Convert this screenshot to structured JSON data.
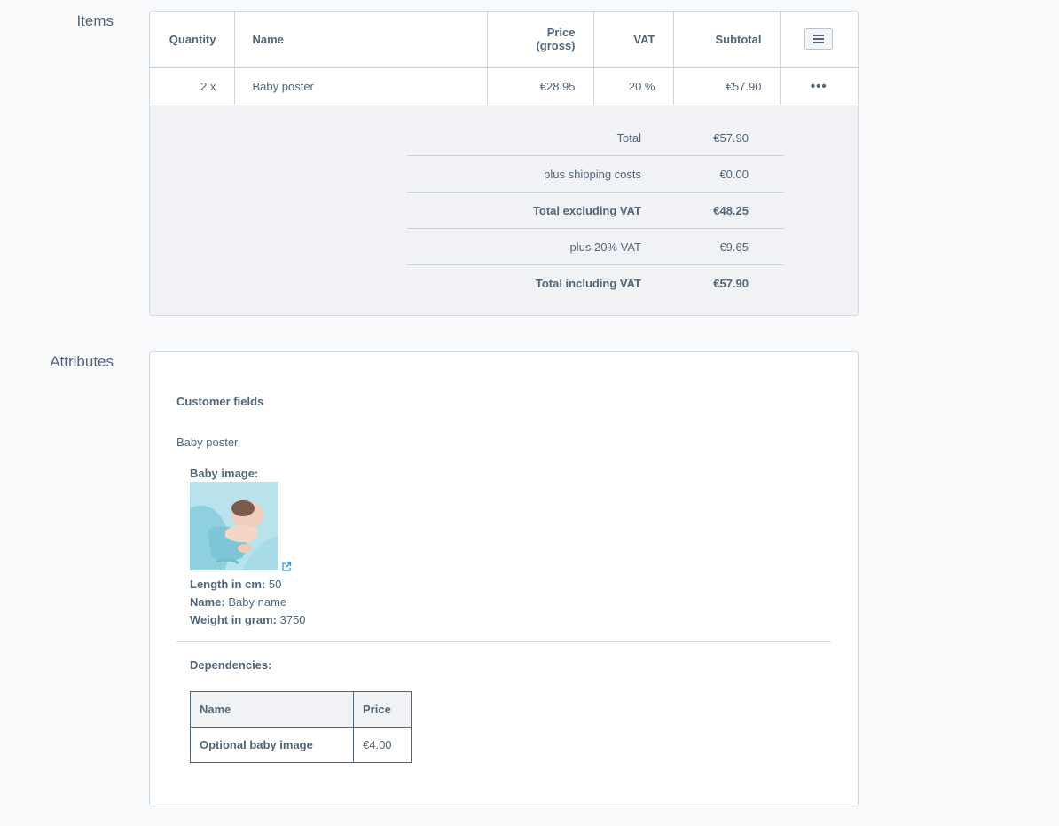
{
  "sections": {
    "items_label": "Items",
    "attributes_label": "Attributes"
  },
  "items": {
    "headers": {
      "quantity": "Quantity",
      "name": "Name",
      "price": "Price (gross)",
      "vat": "VAT",
      "subtotal": "Subtotal"
    },
    "rows": [
      {
        "quantity": "2 x",
        "name": "Baby poster",
        "price": "€28.95",
        "vat": "20 %",
        "subtotal": "€57.90",
        "actions_icon": "ellipsis-icon"
      }
    ],
    "menu_icon": "hamburger-menu-icon"
  },
  "totals": [
    {
      "label": "Total",
      "value": "€57.90",
      "bold": false
    },
    {
      "label": "plus shipping costs",
      "value": "€0.00",
      "bold": false
    },
    {
      "label": "Total excluding VAT",
      "value": "€48.25",
      "bold": true
    },
    {
      "label": "plus 20% VAT",
      "value": "€9.65",
      "bold": false
    },
    {
      "label": "Total including VAT",
      "value": "€57.90",
      "bold": true
    }
  ],
  "attributes": {
    "heading": "Customer fields",
    "product_name": "Baby poster",
    "image_label": "Baby image:",
    "external_link_icon": "external-link-icon",
    "fields": [
      {
        "label": "Length in cm:",
        "value": "50"
      },
      {
        "label": "Name:",
        "value": "Baby name"
      },
      {
        "label": "Weight in gram:",
        "value": "3750"
      }
    ],
    "dependencies_label": "Dependencies:",
    "dependencies": {
      "headers": {
        "name": "Name",
        "price": "Price"
      },
      "rows": [
        {
          "name": "Optional baby image",
          "price": "€4.00"
        }
      ]
    }
  },
  "colors": {
    "page_bg": "#f8f9fa",
    "text": "#52667a",
    "border": "#d1d9e0",
    "totals_bg": "#f0f2f5",
    "link": "#189eff"
  }
}
